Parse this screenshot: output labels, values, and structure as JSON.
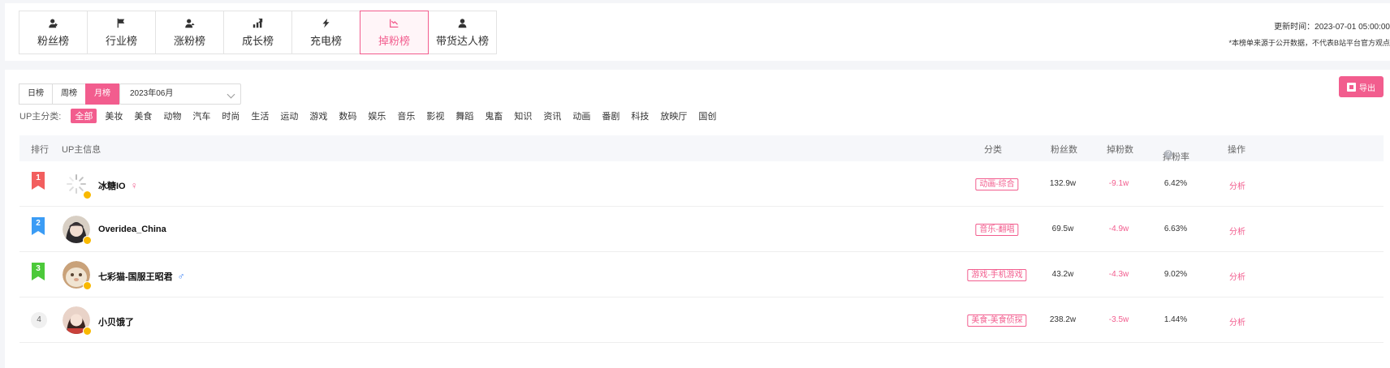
{
  "tabs": [
    {
      "label": "粉丝榜",
      "icon": "fans-icon"
    },
    {
      "label": "行业榜",
      "icon": "flag-icon"
    },
    {
      "label": "涨粉榜",
      "icon": "user-up-icon"
    },
    {
      "label": "成长榜",
      "icon": "growth-icon"
    },
    {
      "label": "充电榜",
      "icon": "lightning-icon"
    },
    {
      "label": "掉粉榜",
      "icon": "chart-down-icon",
      "active": true
    },
    {
      "label": "带货达人榜",
      "icon": "user-icon"
    }
  ],
  "update_time": "更新时间：2023-07-01 05:00:00",
  "disclaimer": "*本榜单来源于公开数据，不代表B站平台官方观点",
  "periods": [
    {
      "label": "日榜"
    },
    {
      "label": "周榜"
    },
    {
      "label": "月榜",
      "active": true
    }
  ],
  "month_select": "2023年06月",
  "export_label": "导出",
  "category_label": "UP主分类:",
  "categories": [
    "全部",
    "美妆",
    "美食",
    "动物",
    "汽车",
    "时尚",
    "生活",
    "运动",
    "游戏",
    "数码",
    "娱乐",
    "音乐",
    "影视",
    "舞蹈",
    "鬼畜",
    "知识",
    "资讯",
    "动画",
    "番剧",
    "科技",
    "放映厅",
    "国创"
  ],
  "active_category": "全部",
  "columns": {
    "rank": "排行",
    "info": "UP主信息",
    "category": "分类",
    "fans": "粉丝数",
    "loss": "掉粉数",
    "loss_rate": "掉粉率",
    "action": "操作"
  },
  "rows": [
    {
      "rank": "1",
      "name": "冰糖IO",
      "sex": "♀",
      "category": "动画-综合",
      "fans": "132.9w",
      "loss": "-9.1w",
      "rate": "6.42%",
      "action": "分析"
    },
    {
      "rank": "2",
      "name": "Overidea_China",
      "sex": "",
      "category": "音乐-翻唱",
      "fans": "69.5w",
      "loss": "-4.9w",
      "rate": "6.63%",
      "action": "分析"
    },
    {
      "rank": "3",
      "name": "七彩猫-国服王昭君",
      "sex": "♂",
      "category": "游戏-手机游戏",
      "fans": "43.2w",
      "loss": "-4.3w",
      "rate": "9.02%",
      "action": "分析"
    },
    {
      "rank": "4",
      "name": "小贝饿了",
      "sex": "",
      "category": "美食-美食侦探",
      "fans": "238.2w",
      "loss": "-3.5w",
      "rate": "1.44%",
      "action": "分析"
    }
  ],
  "colors": {
    "accent": "#f25d8e",
    "rank1": "#f25e5e",
    "rank2": "#3b9cf5",
    "rank3": "#4cc93a",
    "female": "#f25d8e",
    "male": "#3b82f6"
  }
}
